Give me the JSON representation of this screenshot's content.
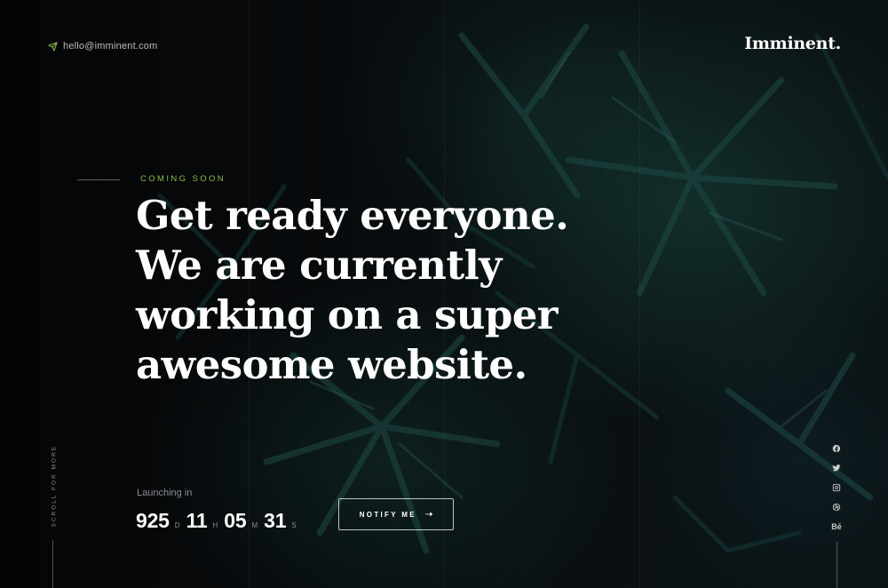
{
  "header": {
    "email": "hello@imminent.com",
    "logo": "Imminent."
  },
  "intro": {
    "eyebrow": "COMING SOON",
    "headline_lines": [
      "Get ready everyone.",
      "We are currently",
      "working on a super",
      "awesome website."
    ]
  },
  "side": {
    "scroll_text": "SCROLL FOR MORE"
  },
  "launch": {
    "label": "Launching in",
    "days": "925",
    "days_unit": "D",
    "hours": "11",
    "hours_unit": "H",
    "minutes": "05",
    "minutes_unit": "M",
    "seconds": "31",
    "seconds_unit": "S"
  },
  "cta": {
    "notify_label": "NOTIFY ME",
    "arrow": "➝"
  },
  "social": {
    "items": [
      {
        "name": "facebook-icon"
      },
      {
        "name": "twitter-icon"
      },
      {
        "name": "instagram-icon"
      },
      {
        "name": "dribbble-icon"
      },
      {
        "name": "behance-icon",
        "text": "Bē"
      }
    ]
  },
  "colors": {
    "accent": "#8bbf4a",
    "background": "#07090a"
  }
}
